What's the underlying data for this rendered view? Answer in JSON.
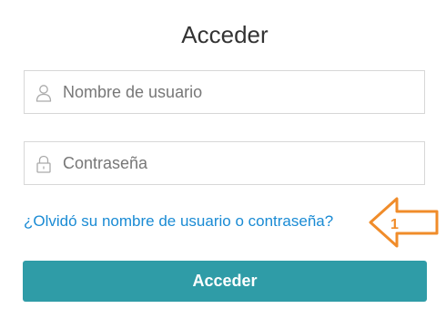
{
  "login": {
    "title": "Acceder",
    "username": {
      "placeholder": "Nombre de usuario",
      "icon": "user-icon"
    },
    "password": {
      "placeholder": "Contraseña",
      "icon": "lock-icon"
    },
    "forgot_link": "¿Olvidó su nombre de usuario o contraseña?",
    "submit_label": "Acceder"
  },
  "annotation": {
    "number": "1",
    "icon": "arrow-left-icon",
    "color": "#f08c2a"
  },
  "colors": {
    "button": "#2f9ca7",
    "link": "#1a8bd4"
  }
}
